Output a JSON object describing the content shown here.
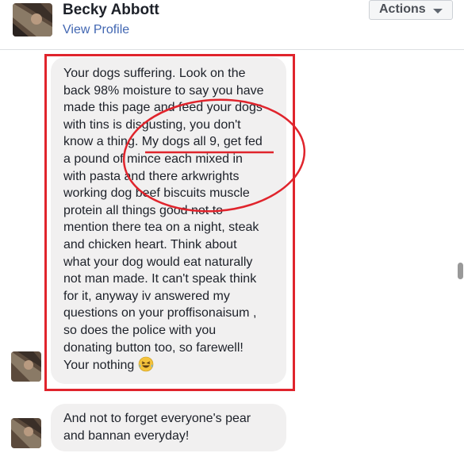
{
  "header": {
    "name": "Becky Abbott",
    "view_profile": "View Profile",
    "actions_label": "Actions"
  },
  "messages": [
    {
      "lines": [
        "Your dogs suffering. Look on the",
        "back 98% moisture to say you have",
        "made this page and feed your dogs",
        "with tins is disgusting, you don't",
        "know a thing. My dogs all 9, get fed",
        "a pound of mince each mixed in",
        "with pasta and there arkwrights",
        "working dog beef biscuits muscle",
        "protein all things good not to",
        "mention there tea on a night, steak",
        "and chicken heart. Think about",
        "what your dog would eat naturally",
        "not man made. It can't speak think",
        "for it, anyway iv answered my",
        "questions on your proffisonaisum ,",
        "so does the police with you",
        "donating button too, so farewell!",
        "Your nothing"
      ]
    },
    {
      "lines": [
        "And not to forget everyone's pear",
        "and bannan everyday!"
      ]
    }
  ],
  "annotation": {
    "color": "#e0242c",
    "icons": [
      "laughing-tears-emoji"
    ]
  }
}
